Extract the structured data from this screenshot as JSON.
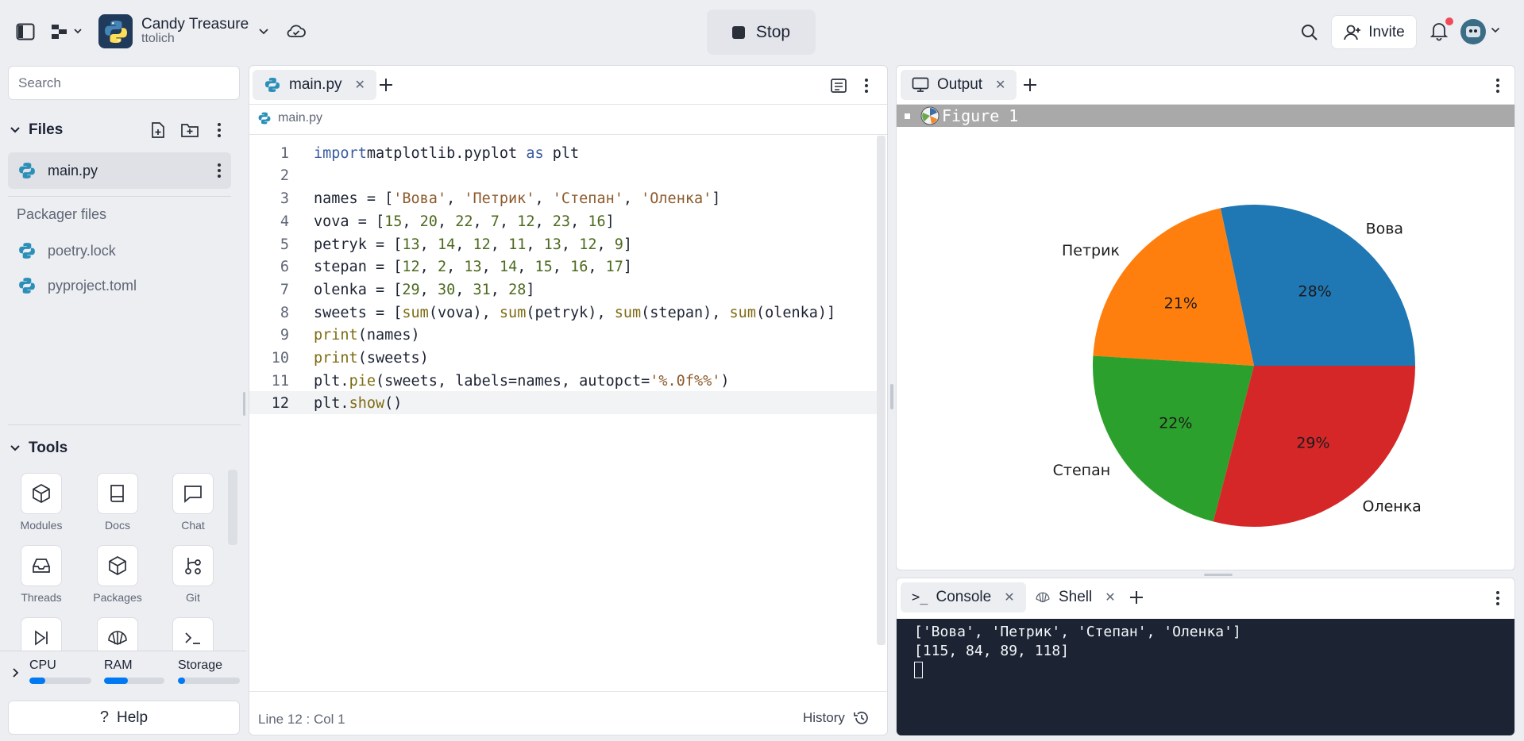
{
  "topbar": {
    "project_name": "Candy Treasure",
    "project_owner": "ttolich",
    "stop_label": "Stop",
    "invite_label": "Invite"
  },
  "sidebar": {
    "search_placeholder": "Search",
    "files_header": "Files",
    "files": [
      {
        "name": "main.py"
      }
    ],
    "packager_header": "Packager files",
    "packager_files": [
      {
        "name": "poetry.lock"
      },
      {
        "name": "pyproject.toml"
      }
    ],
    "tools_header": "Tools",
    "tools": [
      {
        "label": "Modules",
        "icon": "cube-icon"
      },
      {
        "label": "Docs",
        "icon": "book-icon"
      },
      {
        "label": "Chat",
        "icon": "chat-icon"
      },
      {
        "label": "Threads",
        "icon": "inbox-icon"
      },
      {
        "label": "Packages",
        "icon": "package-icon"
      },
      {
        "label": "Git",
        "icon": "git-icon"
      },
      {
        "label": "",
        "icon": "play-step-icon"
      },
      {
        "label": "",
        "icon": "shell-icon"
      },
      {
        "label": "",
        "icon": "terminal-icon"
      }
    ],
    "resources": [
      {
        "label": "CPU",
        "level": 0.25
      },
      {
        "label": "RAM",
        "level": 0.4
      },
      {
        "label": "Storage",
        "level": 0.12
      }
    ],
    "help_label": "Help"
  },
  "editor": {
    "tab_label": "main.py",
    "breadcrumb": "main.py",
    "status": "Line 12 : Col 1",
    "history_label": "History",
    "lines": [
      [
        [
          "kw",
          "import"
        ],
        [
          "",
          "matplotlib.pyplot "
        ],
        [
          "kw",
          "as"
        ],
        [
          "",
          " plt"
        ]
      ],
      [],
      [
        [
          "",
          "names = ["
        ],
        [
          "str",
          "'Вова'"
        ],
        [
          "",
          ", "
        ],
        [
          "str",
          "'Петрик'"
        ],
        [
          "",
          ", "
        ],
        [
          "str",
          "'Степан'"
        ],
        [
          "",
          ", "
        ],
        [
          "str",
          "'Оленка'"
        ],
        [
          "",
          "]"
        ]
      ],
      [
        [
          "",
          "vova = ["
        ],
        [
          "num",
          "15"
        ],
        [
          "",
          ", "
        ],
        [
          "num",
          "20"
        ],
        [
          "",
          ", "
        ],
        [
          "num",
          "22"
        ],
        [
          "",
          ", "
        ],
        [
          "num",
          "7"
        ],
        [
          "",
          ", "
        ],
        [
          "num",
          "12"
        ],
        [
          "",
          ", "
        ],
        [
          "num",
          "23"
        ],
        [
          "",
          ", "
        ],
        [
          "num",
          "16"
        ],
        [
          "",
          "]"
        ]
      ],
      [
        [
          "",
          "petryk = ["
        ],
        [
          "num",
          "13"
        ],
        [
          "",
          ", "
        ],
        [
          "num",
          "14"
        ],
        [
          "",
          ", "
        ],
        [
          "num",
          "12"
        ],
        [
          "",
          ", "
        ],
        [
          "num",
          "11"
        ],
        [
          "",
          ", "
        ],
        [
          "num",
          "13"
        ],
        [
          "",
          ", "
        ],
        [
          "num",
          "12"
        ],
        [
          "",
          ", "
        ],
        [
          "num",
          "9"
        ],
        [
          "",
          "]"
        ]
      ],
      [
        [
          "",
          "stepan = ["
        ],
        [
          "num",
          "12"
        ],
        [
          "",
          ", "
        ],
        [
          "num",
          "2"
        ],
        [
          "",
          ", "
        ],
        [
          "num",
          "13"
        ],
        [
          "",
          ", "
        ],
        [
          "num",
          "14"
        ],
        [
          "",
          ", "
        ],
        [
          "num",
          "15"
        ],
        [
          "",
          ", "
        ],
        [
          "num",
          "16"
        ],
        [
          "",
          ", "
        ],
        [
          "num",
          "17"
        ],
        [
          "",
          "]"
        ]
      ],
      [
        [
          "",
          "olenka = ["
        ],
        [
          "num",
          "29"
        ],
        [
          "",
          ", "
        ],
        [
          "num",
          "30"
        ],
        [
          "",
          ", "
        ],
        [
          "num",
          "31"
        ],
        [
          "",
          ", "
        ],
        [
          "num",
          "28"
        ],
        [
          "",
          "]"
        ]
      ],
      [
        [
          "",
          "sweets = ["
        ],
        [
          "fn",
          "sum"
        ],
        [
          "",
          "(vova), "
        ],
        [
          "fn",
          "sum"
        ],
        [
          "",
          "(petryk), "
        ],
        [
          "fn",
          "sum"
        ],
        [
          "",
          "(stepan), "
        ],
        [
          "fn",
          "sum"
        ],
        [
          "",
          "(olenka)]"
        ]
      ],
      [
        [
          "fn",
          "print"
        ],
        [
          "",
          "(names)"
        ]
      ],
      [
        [
          "fn",
          "print"
        ],
        [
          "",
          "(sweets)"
        ]
      ],
      [
        [
          "",
          "plt."
        ],
        [
          "fn",
          "pie"
        ],
        [
          "",
          "(sweets, labels=names, autopct="
        ],
        [
          "str",
          "'%.0f%%'"
        ],
        [
          "",
          ")"
        ]
      ],
      [
        [
          "",
          "plt."
        ],
        [
          "fn",
          "show"
        ],
        [
          "",
          "()"
        ]
      ]
    ]
  },
  "output": {
    "tab_label": "Output",
    "figure_title": "Figure 1",
    "chart_data": {
      "type": "pie",
      "categories": [
        "Вова",
        "Петрик",
        "Степан",
        "Оленка"
      ],
      "values": [
        115,
        84,
        89,
        118
      ],
      "data_labels": [
        "28%",
        "21%",
        "22%",
        "29%"
      ],
      "colors": [
        "#1f77b4",
        "#ff7f0e",
        "#2ca02c",
        "#d62728"
      ]
    }
  },
  "console": {
    "tab_console": "Console",
    "tab_shell": "Shell",
    "lines": [
      "['Вова', 'Петрик', 'Степан', 'Оленка']",
      "[115, 84, 89, 118]"
    ]
  }
}
